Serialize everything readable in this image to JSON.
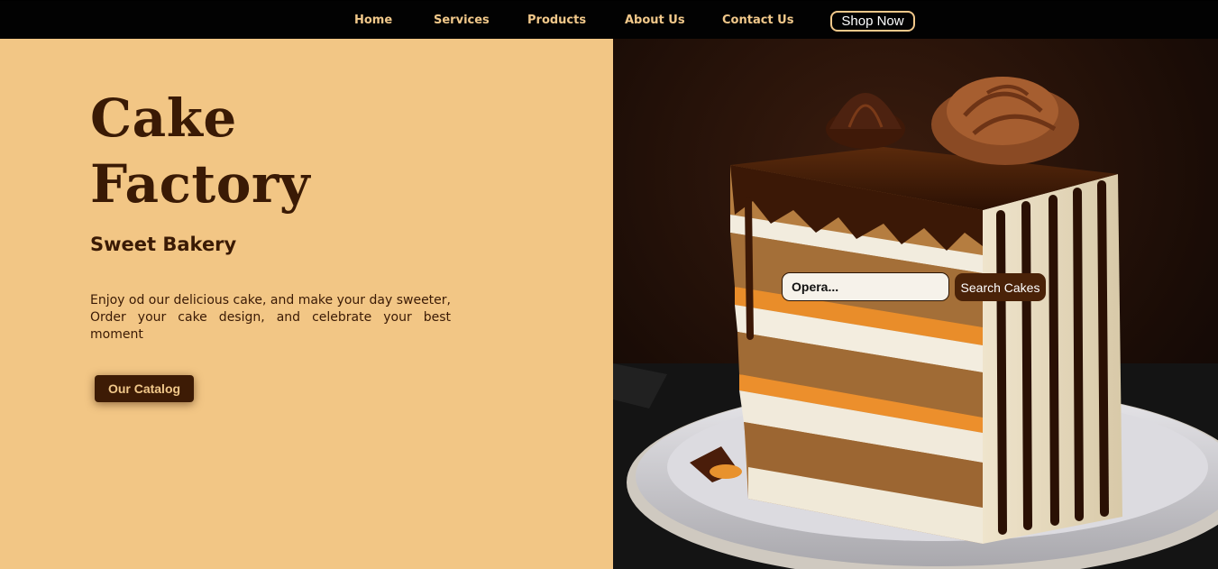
{
  "nav": {
    "items": [
      "Home",
      "Services",
      "Products",
      "About Us",
      "Contact Us"
    ],
    "shop_label": "Shop Now"
  },
  "hero": {
    "title_line1": "Cake",
    "title_line2": "Factory",
    "subtitle": "Sweet Bakery",
    "description": "Enjoy od our delicious cake, and make your day sweeter, Order your cake design, and celebrate your best moment",
    "catalog_label": "Our Catalog"
  },
  "search": {
    "value": "Opera...",
    "button_label": "Search Cakes"
  },
  "colors": {
    "accent": "#f1c88a",
    "panel": "#f2c685",
    "dark_brown": "#3a1a05",
    "nav_bg": "#020202"
  },
  "image": {
    "icon": "layered-chocolate-cake-photo"
  }
}
